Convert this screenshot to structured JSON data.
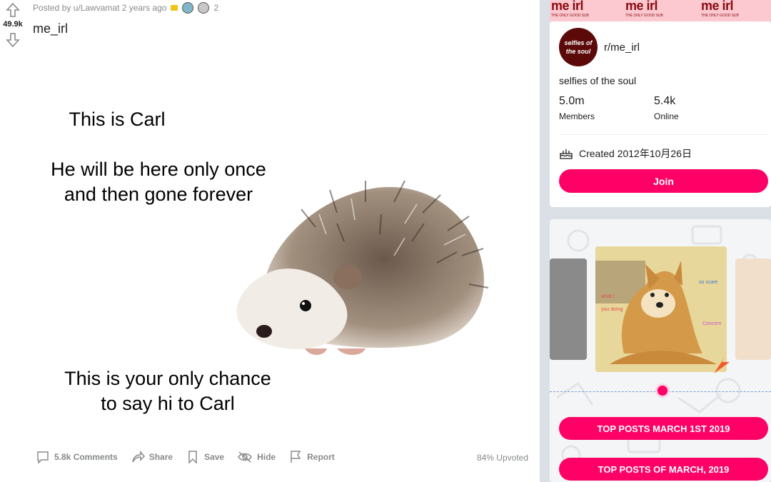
{
  "post": {
    "score": "49.9k",
    "posted_by": "Posted by u/Lawvamat 2 years ago",
    "award_count": "2",
    "title": "me_irl",
    "meme": {
      "line1": "This is Carl",
      "line2a": "He will be here only once",
      "line2b": "and then gone forever",
      "line3a": "This is your only chance",
      "line3b": "to say hi to Carl"
    },
    "actions": {
      "comments": "5.8k Comments",
      "share": "Share",
      "save": "Save",
      "hide": "Hide",
      "report": "Report"
    },
    "upvoted": "84% Upvoted"
  },
  "sidebar": {
    "banner_text": "me irl",
    "banner_small": "THE ONLY GOOD SUB",
    "avatar_text": "selfies of the soul",
    "subreddit_name": "r/me_irl",
    "description": "selfies of the soul",
    "members_count": "5.0m",
    "members_label": "Members",
    "online_count": "5.4k",
    "online_label": "Online",
    "created": "Created 2012年10月26日",
    "join_label": "Join",
    "carousel": {
      "doge_text1": "so scare",
      "doge_text2": "what r",
      "doge_text3": "you doing",
      "doge_text4": "Concern"
    },
    "top_posts_day": "TOP POSTS MARCH 1ST 2019",
    "top_posts_month": "TOP POSTS OF MARCH, 2019"
  },
  "colors": {
    "accent": "#ff0066",
    "banner": "#fbc9cf"
  }
}
